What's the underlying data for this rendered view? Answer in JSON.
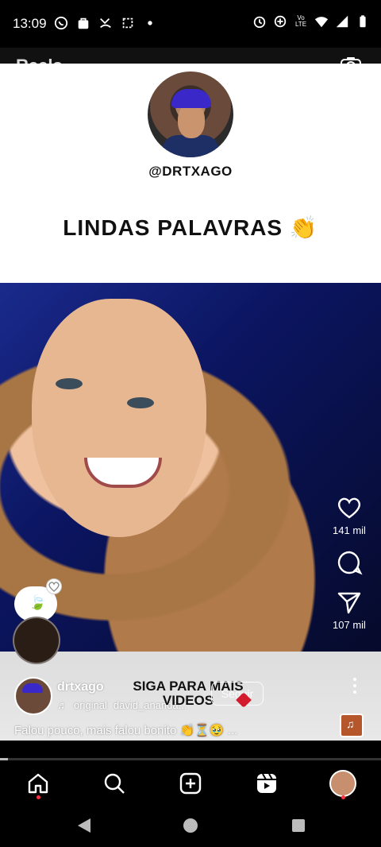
{
  "status_bar": {
    "time": "13:09",
    "icons_left": [
      "whatsapp-icon",
      "shopping-icon",
      "missed-call-icon",
      "screenshot-icon",
      "dot-icon"
    ],
    "icons_right": [
      "alarm-icon",
      "data-saver-icon",
      "volte-icon",
      "wifi-icon",
      "signal-icon",
      "battery-icon"
    ],
    "volte_label": "Vo LTE"
  },
  "header": {
    "title": "Reels",
    "camera_icon": "camera-icon"
  },
  "post_card": {
    "handle": "@DRTXAGO",
    "headline": "LINDAS PALAVRAS 👏"
  },
  "actions": {
    "like_count": "141 mil",
    "comment_icon": "comment-icon",
    "share_count": "107 mil"
  },
  "footer": {
    "username": "drtxago",
    "audio_label": "original",
    "audio_artist": "david_ananda...",
    "overlay_text": "SIGA PARA MAIS VIDEOS",
    "follow_label": "Seguir",
    "caption": "Falou pouco, mais falou bonito 👏⏳🥹 ..."
  },
  "progress": {
    "fraction": 0.02
  },
  "bottom_nav": {
    "items": [
      "home-icon",
      "search-icon",
      "create-icon",
      "reels-icon",
      "profile-icon"
    ]
  },
  "colors": {
    "accent_red": "#ff3040",
    "background": "#000000"
  }
}
